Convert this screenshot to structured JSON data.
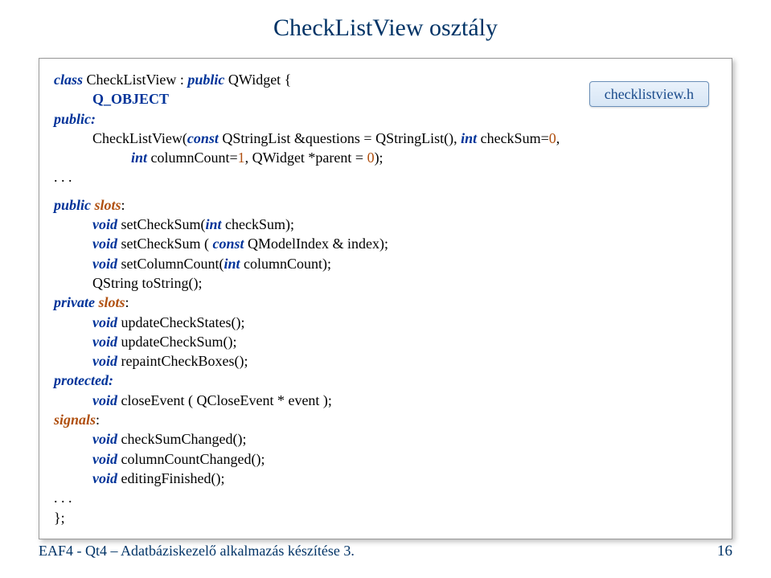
{
  "title": "CheckListView  osztály",
  "badge": "checklistview.h",
  "code": {
    "l1a": "class ",
    "l1b": "CheckListView : ",
    "l1c": "public ",
    "l1d": "QWidget {",
    "l2": "Q_OBJECT",
    "l3": "public:",
    "l4a": "CheckListView(",
    "l4b": "const ",
    "l4c": "QStringList &questions = QStringList(), ",
    "l4d": "int ",
    "l4e": "checkSum=",
    "l4f": "0",
    "l4g": ",",
    "l5a": "int ",
    "l5b": "columnCount=",
    "l5c": "1",
    "l5d": ", QWidget *parent = ",
    "l5e": "0",
    "l5f": ");",
    "l6": ". . .",
    "l7a": "public ",
    "l7b": "slots",
    "l7c": ":",
    "l8a": "void ",
    "l8b": "setCheckSum(",
    "l8c": "int ",
    "l8d": "checkSum);",
    "l9a": "void ",
    "l9b": "setCheckSum ( ",
    "l9c": "const ",
    "l9d": "QModelIndex & index);",
    "l10a": "void ",
    "l10b": "setColumnCount(",
    "l10c": "int ",
    "l10d": "columnCount);",
    "l11": "QString toString();",
    "l12a": "private ",
    "l12b": "slots",
    "l12c": ":",
    "l13a": "void ",
    "l13b": "updateCheckStates();",
    "l14a": "void ",
    "l14b": "updateCheckSum();",
    "l15a": "void ",
    "l15b": "repaintCheckBoxes();",
    "l16": "protected:",
    "l17a": "void ",
    "l17b": "closeEvent ( QCloseEvent * event );",
    "l18a": "signals",
    "l18b": ":",
    "l19a": "void ",
    "l19b": "checkSumChanged();",
    "l20a": "void ",
    "l20b": "columnCountChanged();",
    "l21a": "void ",
    "l21b": "editingFinished();",
    "l22": ". . .",
    "l23": "};"
  },
  "footer": {
    "left": "EAF4 - Qt4 – Adatbáziskezelő alkalmazás készítése 3.",
    "page": "16"
  }
}
